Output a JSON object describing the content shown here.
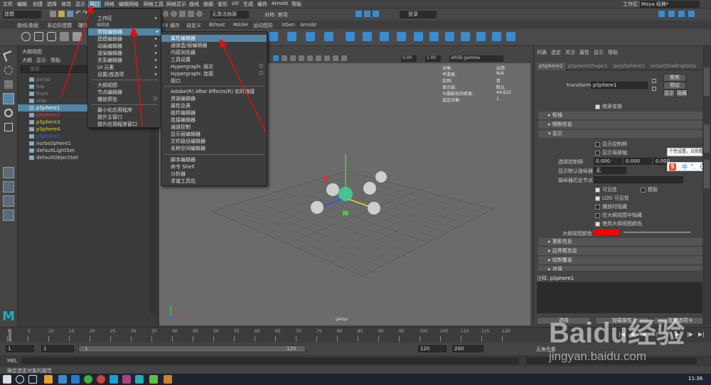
{
  "menubar": {
    "items": [
      "文件",
      "编辑",
      "创建",
      "选择",
      "修改",
      "显示",
      "窗口",
      "网格",
      "编辑网格",
      "网格工具",
      "网格显示",
      "曲线",
      "曲面",
      "变形",
      "UV",
      "生成",
      "缓存",
      "Arnold",
      "帮助"
    ],
    "workspace_label": "工作区：",
    "workspace_value": "Maya 经典*"
  },
  "shelf": {
    "mode": "建模",
    "surface_value": "无激活曲面",
    "symmetry_label": "对称: 禁用",
    "login": "登录"
  },
  "shelf_tabs": [
    "曲线/曲面",
    "多边形建模",
    "雕刻",
    "FX 缓存",
    "自定义",
    "Bifrost",
    "MASH",
    "运动图形",
    "XGen",
    "Arnold"
  ],
  "window_menu": {
    "items": [
      "工作区",
      "编辑器",
      "常规编辑器",
      "建模编辑器",
      "动画编辑器",
      "渲染编辑器",
      "关系编辑器",
      "UI 元素",
      "设置/首选项",
      "大纲视图",
      "节点编辑器",
      "播放预览",
      "最小化应用程序",
      "提升主窗口",
      "提升应用程序窗口"
    ]
  },
  "general_editors_menu": {
    "items": [
      "属性编辑器",
      "通道盒/层编辑器",
      "内容浏览器",
      "工具设置",
      "Hypergraph: 层次",
      "Hypergraph: 连接",
      "视口",
      "Adobe(R) After Effects(R) 实时链接",
      "资源编辑器",
      "属性总表",
      "组件编辑器",
      "连接编辑器",
      "通道控制",
      "显示层编辑器",
      "文件路径编辑器",
      "名称空间编辑器",
      "脚本编辑器",
      "命令 Shell",
      "分析器",
      "求值工具包"
    ]
  },
  "outliner": {
    "title": "大纲视图",
    "menu": [
      "大纲",
      "显示",
      "帮助"
    ],
    "search_placeholder": "搜索...",
    "items": [
      {
        "name": "persp",
        "color": "#8a8a8a"
      },
      {
        "name": "top",
        "color": "#8a8a8a"
      },
      {
        "name": "front",
        "color": "#8a8a8a"
      },
      {
        "name": "side",
        "color": "#8a8a8a"
      },
      {
        "name": "pSphere1",
        "color": "#ffffff"
      },
      {
        "name": "pSphere2",
        "color": "#e04040"
      },
      {
        "name": "pSphere3",
        "color": "#e8d020"
      },
      {
        "name": "pSphere4",
        "color": "#e8d020"
      },
      {
        "name": "pSphere5",
        "color": "#3060e0"
      },
      {
        "name": "nurbsSphere1",
        "color": "#cccccc"
      },
      {
        "name": "defaultLightSet",
        "color": "#cccccc"
      },
      {
        "name": "defaultObjectSet",
        "color": "#cccccc"
      }
    ]
  },
  "viewport": {
    "time_a": "0.00",
    "time_b": "1.00",
    "color_space": "sRGB gamma",
    "camera_label": "persp",
    "hud": [
      {
        "k": "对象:",
        "v": "启用"
      },
      {
        "k": "平滑度:",
        "v": "N/A"
      },
      {
        "k": "实例:",
        "v": "否"
      },
      {
        "k": "显示层:",
        "v": "默认"
      },
      {
        "k": "与摄影机的距离:",
        "v": "44.622"
      },
      {
        "k": "选定对象:",
        "v": "1"
      }
    ]
  },
  "attr_editor": {
    "menu": [
      "列表",
      "选定",
      "关注",
      "属性",
      "显示",
      "帮助"
    ],
    "tabs": [
      "pSphere1",
      "pSphereShape1",
      "polySphere1",
      "initialShadingGrou"
    ],
    "transform_label": "transform:",
    "transform_value": "pSphere1",
    "buttons": [
      "聚焦",
      "预设",
      "显示",
      "隐藏"
    ],
    "keep_transform": "继承变换",
    "sections": [
      "枢轴",
      "限制信息",
      "显示"
    ],
    "display_opts": [
      "显示控制柄",
      "显示局部轴"
    ],
    "select_handle_label": "选择控制柄",
    "select_handle_vals": [
      "0.000",
      "0.000",
      "0.000"
    ],
    "manip_label": "显示默认操纵器",
    "manip_value": "无",
    "history_label": "操纵器历史节点",
    "vis_opts": [
      "可见性",
      "模板",
      "LOD 可见性",
      "播放时隐藏",
      "在大纲视图中隐藏",
      "使用大纲视图颜色"
    ],
    "outliner_color_label": "大纲视图颜色",
    "outliner_color": "#ff0000",
    "more_sections": [
      "重影信息",
      "边界框信息",
      "绘制覆盖",
      "选择"
    ],
    "notes_label": "注释:",
    "notes_value": "pSphere1",
    "bottom_buttons": [
      "选择",
      "加载属性",
      "复制选项卡"
    ]
  },
  "ime": {
    "tooltip": "个性设置，点我看",
    "label": "中"
  },
  "timeslider": {
    "ticks": [
      "1",
      "5",
      "10",
      "15",
      "20",
      "25",
      "30",
      "35",
      "40",
      "45",
      "50",
      "55",
      "60",
      "65",
      "70",
      "75",
      "80",
      "85",
      "90",
      "95",
      "100",
      "105",
      "110",
      "115",
      "120"
    ],
    "current": "1"
  },
  "rangeslider": {
    "start": "1",
    "start2": "1",
    "range_start": "1",
    "range_end": "120",
    "end": "120",
    "end2": "200",
    "char_set": "无角色集"
  },
  "cmdline": {
    "label": "MEL"
  },
  "helpline": {
    "text": "确定选定对象的属性"
  },
  "taskbar": {
    "time": "11:36"
  },
  "watermark": {
    "brand": "Baidu经验",
    "url": "jingyan.baidu.com"
  }
}
